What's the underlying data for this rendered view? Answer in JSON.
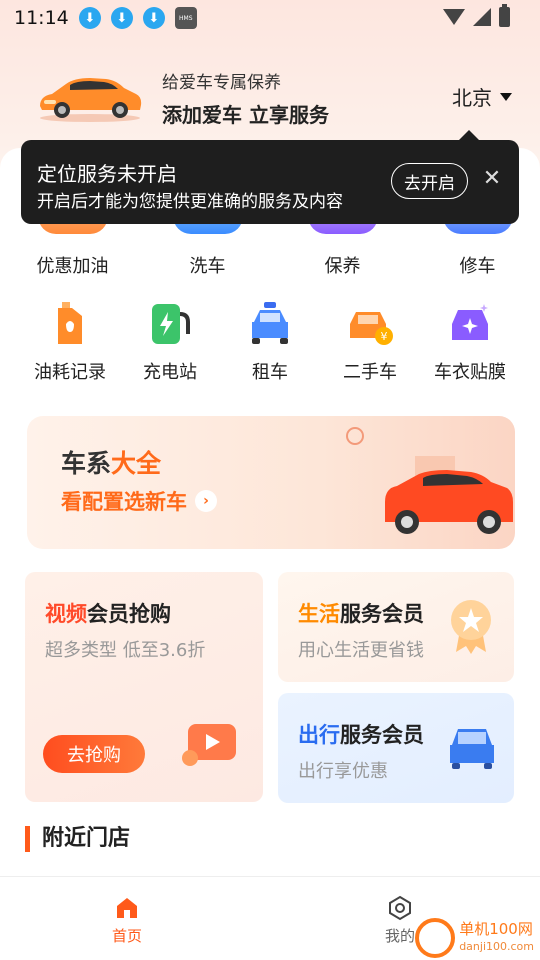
{
  "status_bar": {
    "time": "11:14",
    "hms_label": "HMS"
  },
  "header": {
    "subtitle": "给爱车专属保养",
    "title": "添加爱车 立享服务",
    "city": "北京"
  },
  "location_tip": {
    "title": "定位服务未开启",
    "desc": "开启后才能为您提供更准确的服务及内容",
    "button": "去开启"
  },
  "services_primary": [
    {
      "label": "优惠加油",
      "icon": "fuel-discount-icon",
      "color": "#ff8a3a"
    },
    {
      "label": "洗车",
      "icon": "car-wash-icon",
      "color": "#3a8cff"
    },
    {
      "label": "保养",
      "icon": "maintenance-icon",
      "color": "#8a5cff"
    },
    {
      "label": "修车",
      "icon": "repair-icon",
      "color": "#4a7cff"
    }
  ],
  "services_secondary": [
    {
      "label": "油耗记录",
      "icon": "fuel-record-icon"
    },
    {
      "label": "充电站",
      "icon": "charging-station-icon"
    },
    {
      "label": "租车",
      "icon": "car-rental-icon"
    },
    {
      "label": "二手车",
      "icon": "used-car-icon"
    },
    {
      "label": "车衣贴膜",
      "icon": "car-film-icon"
    }
  ],
  "banner": {
    "title_a": "车系",
    "title_b": "大全",
    "subtitle": "看配置选新车"
  },
  "cards": {
    "video": {
      "title_hl": "视频",
      "title_rest": "会员抢购",
      "subtitle": "超多类型 低至3.6折",
      "button": "去抢购"
    },
    "life": {
      "title_hl": "生活",
      "title_rest": "服务会员",
      "subtitle": "用心生活更省钱"
    },
    "travel": {
      "title_hl": "出行",
      "title_rest": "服务会员",
      "subtitle": "出行享优惠"
    }
  },
  "nearby": {
    "title": "附近门店"
  },
  "tabbar": {
    "home": "首页",
    "mine": "我的"
  },
  "watermark": {
    "name": "单机100网",
    "url": "danji100.com"
  },
  "colors": {
    "accent": "#ff5a1a",
    "tip_bg": "#1e1e1e"
  }
}
